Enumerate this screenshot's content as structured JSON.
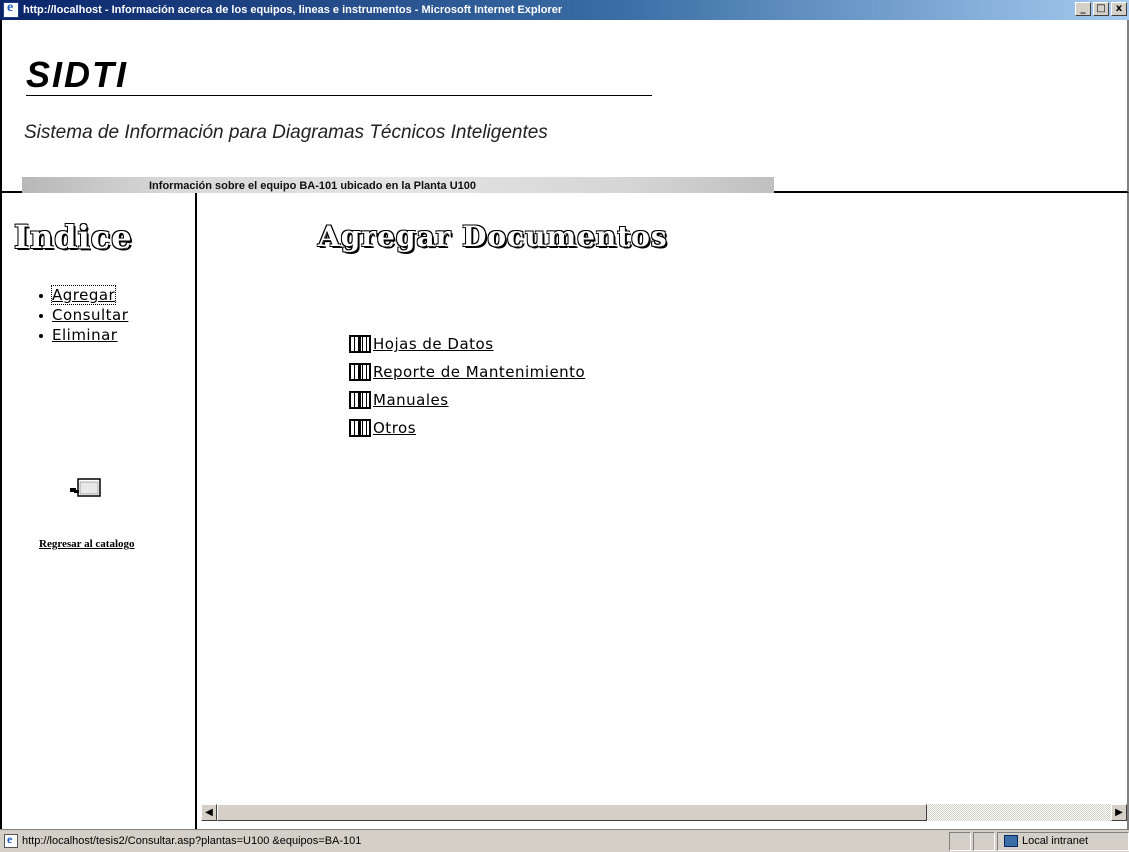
{
  "window": {
    "title": "http://localhost - Información acerca de los equipos, lineas e instrumentos - Microsoft Internet Explorer",
    "minimize": "_",
    "maximize": "□",
    "close": "x"
  },
  "header": {
    "brand": "SIDTI",
    "subtitle": "Sistema de Información para Diagramas Técnicos Inteligentes",
    "banner": "Información sobre el equipo BA-101 ubicado en la Planta U100"
  },
  "sidebar": {
    "title": "Indice",
    "items": [
      {
        "label": "Agregar"
      },
      {
        "label": "Consultar"
      },
      {
        "label": "Eliminar"
      }
    ],
    "back_label": "Regresar al catalogo"
  },
  "main": {
    "title": "Agregar Documentos",
    "documents": [
      {
        "label": "Hojas de Datos"
      },
      {
        "label": "Reporte de Mantenimiento"
      },
      {
        "label": "Manuales"
      },
      {
        "label": "Otros"
      }
    ]
  },
  "statusbar": {
    "url": "http://localhost/tesis2/Consultar.asp?plantas=U100 &equipos=BA-101",
    "zone": "Local intranet"
  }
}
